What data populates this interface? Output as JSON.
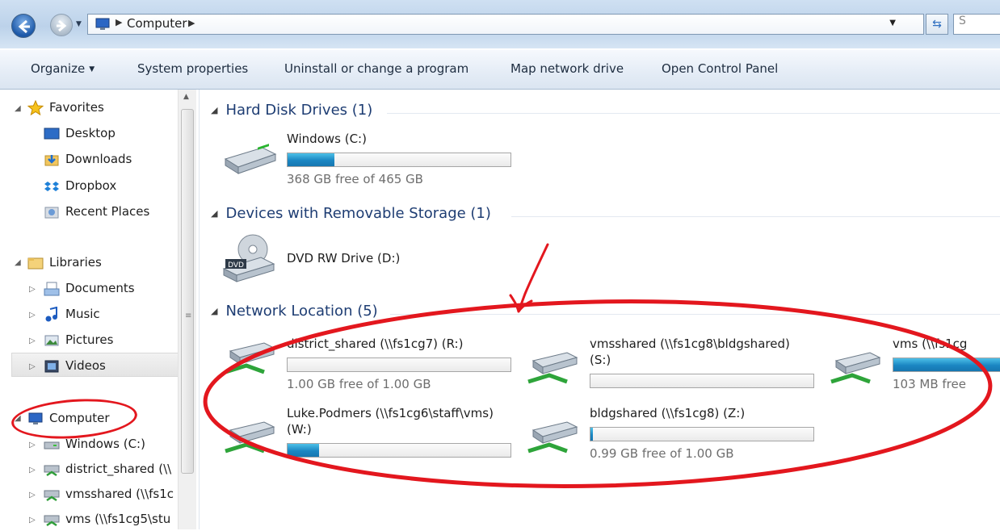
{
  "window": {
    "address": "Computer",
    "search_placeholder": "S"
  },
  "toolbar": {
    "organize": "Organize",
    "system_properties": "System properties",
    "uninstall": "Uninstall or change a program",
    "map_drive": "Map network drive",
    "control_panel": "Open Control Panel"
  },
  "nav": {
    "favorites": "Favorites",
    "desktop": "Desktop",
    "downloads": "Downloads",
    "dropbox": "Dropbox",
    "recent": "Recent Places",
    "libraries": "Libraries",
    "documents": "Documents",
    "music": "Music",
    "pictures": "Pictures",
    "videos": "Videos",
    "computer": "Computer",
    "windows_c": "Windows (C:)",
    "district": "district_shared (\\\\",
    "vmsshared": "vmsshared (\\\\fs1c",
    "vms": "vms (\\\\fs1cg5\\stu"
  },
  "groups": {
    "hdd": "Hard Disk Drives (1)",
    "removable": "Devices with Removable Storage (1)",
    "network": "Network Location (5)"
  },
  "drives": {
    "c": {
      "name": "Windows (C:)",
      "free": "368 GB free of 465 GB",
      "used_fraction": 0.21
    },
    "d": {
      "name": "DVD RW Drive (D:)"
    },
    "r": {
      "name": "district_shared (\\\\fs1cg7) (R:)",
      "free": "1.00 GB free of 1.00 GB",
      "used_fraction": 0.0
    },
    "s": {
      "name": "vmsshared (\\\\fs1cg8\\bldgshared)",
      "name2": "(S:)",
      "used_fraction": 0.0
    },
    "vms": {
      "name": "vms (\\\\fs1cg",
      "free": "103 MB free",
      "used_fraction": 0.9
    },
    "w": {
      "name": "Luke.Podmers (\\\\fs1cg6\\staff\\vms)",
      "name2": "(W:)",
      "used_fraction": 0.14
    },
    "z": {
      "name": "bldgshared (\\\\fs1cg8) (Z:)",
      "free": "0.99 GB free of 1.00 GB",
      "used_fraction": 0.01
    }
  },
  "colors": {
    "annotation": "#e3171e",
    "group_header": "#1e3d73",
    "bar_fill": "#1b86c2"
  }
}
